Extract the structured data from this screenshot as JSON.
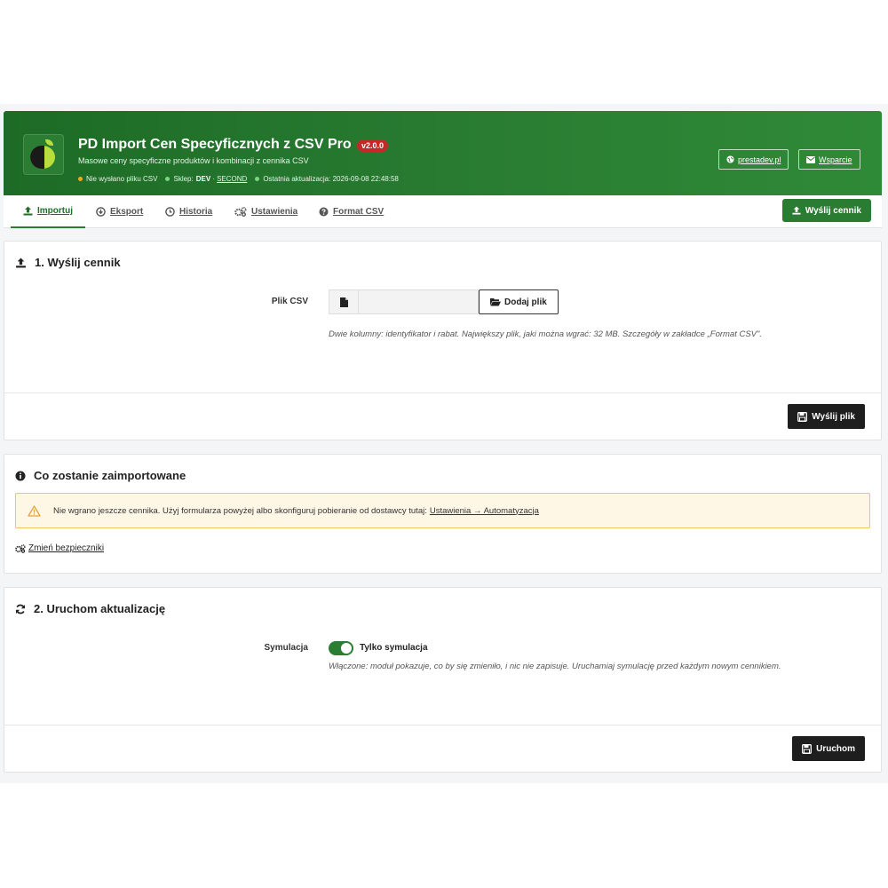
{
  "header": {
    "title": "PD Import Cen Specyficznych z CSV Pro",
    "version": "v2.0.0",
    "subtitle": "Masowe ceny specyficzne produktów i kombinacji z cennika CSV",
    "status": {
      "file_status": "Nie wysłano pliku CSV",
      "shop_label": "Sklep:",
      "shop_value": "DEV",
      "shop_sep": "·",
      "shop_group": "SECOND",
      "last_update_label": "Ostatnia aktualizacja:",
      "last_update_value": "2026-09-08 22:48:58"
    },
    "links": {
      "site": "prestadev.pl",
      "support": "Wsparcie"
    }
  },
  "tabs": [
    {
      "label": "Importuj",
      "icon": "upload-icon",
      "active": true
    },
    {
      "label": "Eksport",
      "icon": "download-circle-icon",
      "active": false
    },
    {
      "label": "Historia",
      "icon": "clock-icon",
      "active": false
    },
    {
      "label": "Ustawienia",
      "icon": "gears-icon",
      "active": false
    },
    {
      "label": "Format CSV",
      "icon": "question-circle-icon",
      "active": false
    }
  ],
  "toolbar": {
    "send_pricelist": "Wyślij cennik"
  },
  "upload_panel": {
    "title": "1. Wyślij cennik",
    "field_label": "Plik CSV",
    "file_value": "",
    "add_file": "Dodaj plik",
    "help_text": "Dwie kolumny: identyfikator i rabat. Największy plik, jaki można wgrać: 32 MB. Szczegóły w zakładce „Format CSV\".",
    "submit": "Wyślij plik"
  },
  "import_panel": {
    "title": "Co zostanie zaimportowane",
    "alert_text": "Nie wgrano jeszcze cennika. Użyj formularza powyżej albo skonfiguruj pobieranie od dostawcy tutaj:",
    "alert_link": "Ustawienia → Automatyzacja",
    "safety_link": "Zmień bezpieczniki"
  },
  "run_panel": {
    "title": "2. Uruchom aktualizację",
    "field_label": "Symulacja",
    "toggle_on": true,
    "toggle_label": "Tylko symulacja",
    "help_text": "Włączone: moduł pokazuje, co by się zmieniło, i nic nie zapisuje. Uruchamiaj symulację przed każdym nowym cennikiem.",
    "submit": "Uruchom"
  },
  "colors": {
    "brand_green": "#2a7e33",
    "badge_red": "#c62828",
    "alert_bg": "#fff7e6",
    "alert_border": "#f2c46a",
    "dark_button": "#1e1e1e"
  }
}
